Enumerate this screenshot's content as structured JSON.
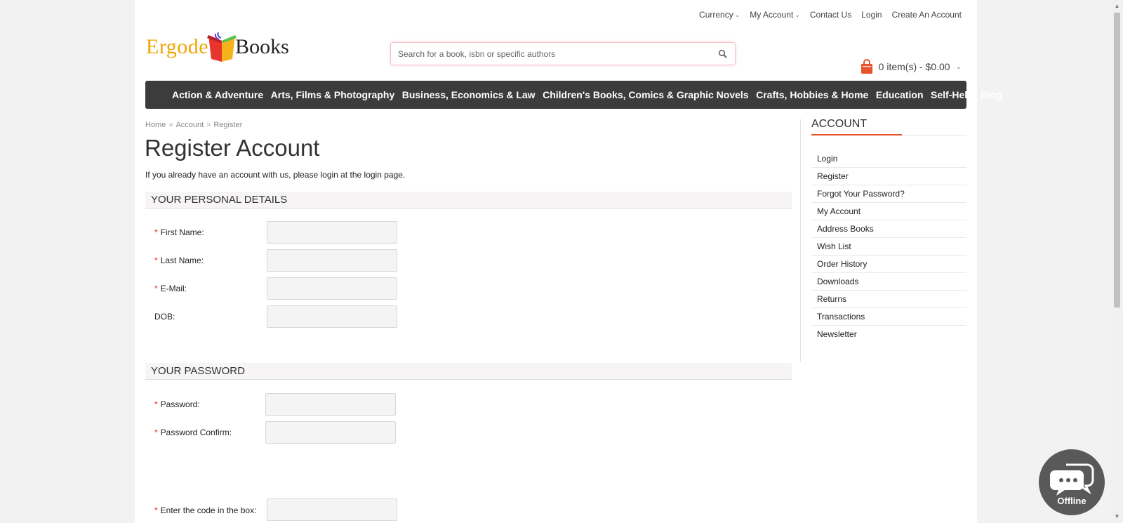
{
  "toplinks": {
    "currency": "Currency",
    "my_account": "My Account",
    "contact_us": "Contact Us",
    "login": "Login",
    "create_account": "Create An Account"
  },
  "logo": {
    "part1": "Ergode",
    "part2": "Books"
  },
  "search": {
    "placeholder": "Search for a book, isbn or specific authors",
    "value": ""
  },
  "cart": {
    "summary": "0 item(s) - $0.00"
  },
  "nav": {
    "items": [
      "Action & Adventure",
      "Arts, Films & Photography",
      "Business, Economics & Law",
      "Children's Books, Comics & Graphic Novels",
      "Crafts, Hobbies & Home",
      "Education",
      "Self-Help",
      "Blog"
    ]
  },
  "breadcrumb": {
    "home": "Home",
    "account": "Account",
    "register": "Register",
    "sep": "»"
  },
  "main": {
    "title": "Register Account",
    "intro": "If you already have an account with us, please login at the login page.",
    "personal_heading": "YOUR PERSONAL DETAILS",
    "password_heading": "YOUR PASSWORD",
    "fields": {
      "first_name": "First Name:",
      "last_name": "Last Name:",
      "email": "E-Mail:",
      "dob": "DOB:",
      "password": "Password:",
      "password_confirm": "Password Confirm:",
      "captcha": "Enter the code in the box:"
    },
    "required_mark": "*"
  },
  "sidebar": {
    "title": "ACCOUNT",
    "items": [
      "Login",
      "Register",
      "Forgot Your Password?",
      "My Account",
      "Address Books",
      "Wish List",
      "Order History",
      "Downloads",
      "Returns",
      "Transactions",
      "Newsletter"
    ]
  },
  "chat": {
    "status": "Offline"
  },
  "colors": {
    "accent": "#e8542a",
    "nav_bg": "#3c3c3c",
    "required": "#e22222"
  }
}
